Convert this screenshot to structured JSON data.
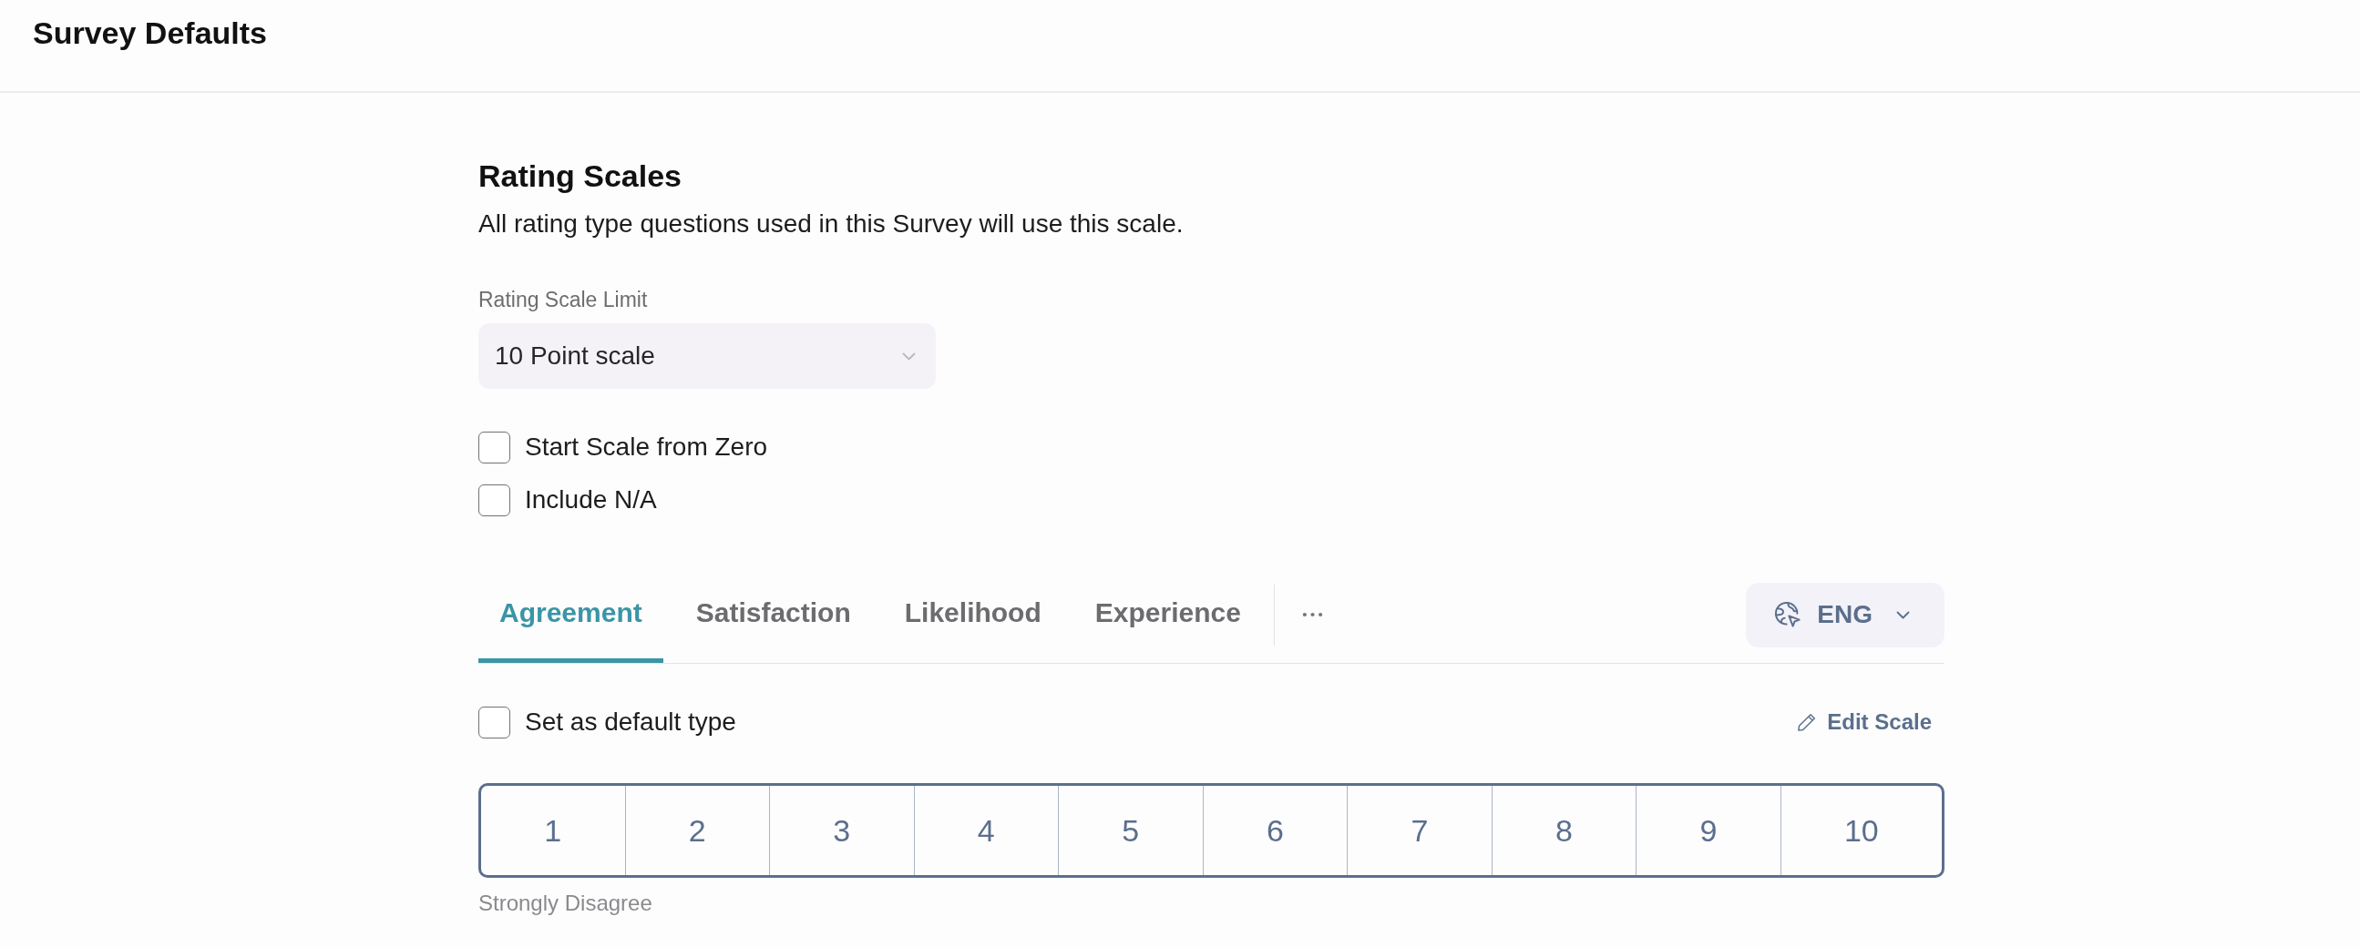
{
  "header": {
    "title": "Survey Defaults"
  },
  "section": {
    "title": "Rating Scales",
    "description": "All rating type questions used in this Survey will use this scale."
  },
  "scale_limit": {
    "label": "Rating Scale Limit",
    "value": "10 Point scale"
  },
  "options": [
    {
      "label": "Start Scale from Zero",
      "checked": false
    },
    {
      "label": "Include N/A",
      "checked": false
    }
  ],
  "tabs": [
    {
      "label": "Agreement",
      "selected": true
    },
    {
      "label": "Satisfaction",
      "selected": false
    },
    {
      "label": "Likelihood",
      "selected": false
    },
    {
      "label": "Experience",
      "selected": false
    }
  ],
  "language": {
    "label": "ENG"
  },
  "default_type": {
    "label": "Set as default type",
    "checked": false
  },
  "edit_scale": {
    "label": "Edit Scale"
  },
  "scale": {
    "points": [
      "1",
      "2",
      "3",
      "4",
      "5",
      "6",
      "7",
      "8",
      "9",
      "10"
    ],
    "low_label": "Strongly Disagree"
  }
}
